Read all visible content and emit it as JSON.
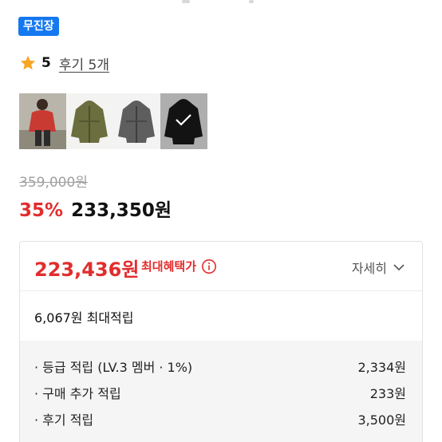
{
  "store": {
    "badge": "무진장"
  },
  "rating": {
    "score": "5",
    "reviews": "후기 5개",
    "icon": "star-icon",
    "star_color": "#f5a623"
  },
  "thumbnails": [
    {
      "name": "model-photo",
      "selected": false
    },
    {
      "name": "khaki-jacket",
      "selected": false
    },
    {
      "name": "gray-jacket",
      "selected": false
    },
    {
      "name": "black-jacket",
      "selected": true
    }
  ],
  "pricing": {
    "original": "359,000원",
    "discount": "35%",
    "sale": "233,350원"
  },
  "benefit": {
    "max_price": "223,436원",
    "max_label": "최대혜택가",
    "detail_label": "자세히",
    "points_total": "6,067원 최대적립",
    "points": [
      {
        "label": "· 등급 적립 (LV.3 멤버 · 1%)",
        "value": "2,334원"
      },
      {
        "label": "· 구매 추가 적립",
        "value": "233원"
      },
      {
        "label": "· 후기 적립",
        "value": "3,500원"
      }
    ]
  },
  "colors": {
    "accent_red": "#e22d2d",
    "badge_blue": "#1478f0"
  }
}
